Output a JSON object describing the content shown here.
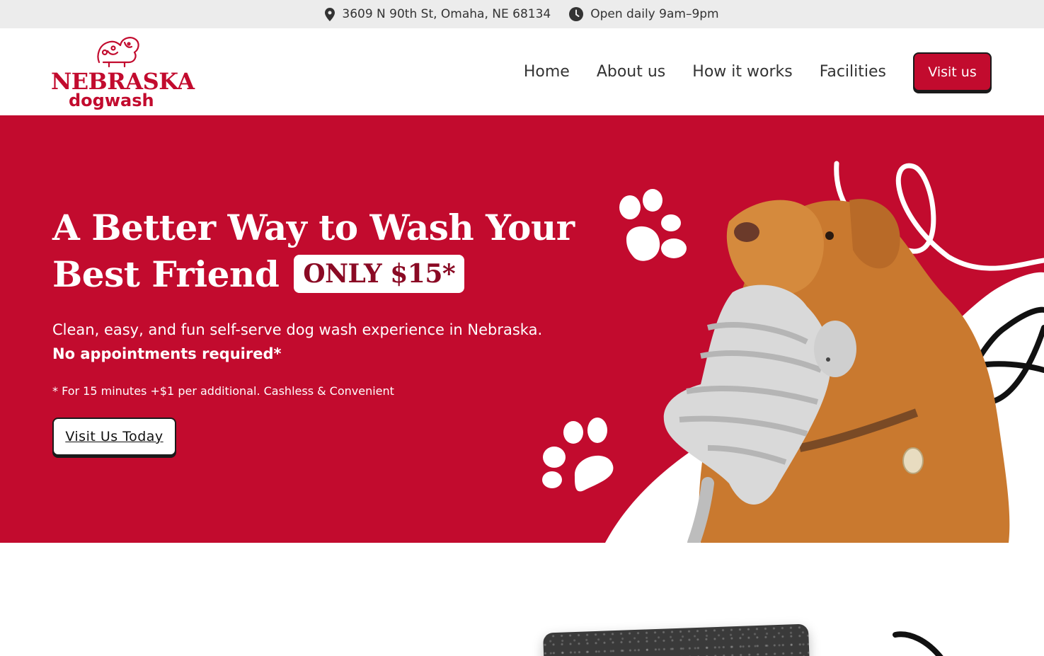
{
  "topbar": {
    "address": "3609 N 90th St, Omaha, NE 68134",
    "address_icon": "location-pin-icon",
    "hours": "Open daily 9am–9pm",
    "hours_icon": "clock-icon"
  },
  "brand": {
    "name_line1": "NEBRASKA",
    "name_line2": "dogwash",
    "color": "#c20b2e"
  },
  "nav": {
    "items": [
      {
        "label": "Home"
      },
      {
        "label": "About us"
      },
      {
        "label": "How it works"
      },
      {
        "label": "Facilities"
      }
    ],
    "cta_label": "Visit us"
  },
  "hero": {
    "title": "A Better Way to Wash Your Best Friend",
    "badge": "ONLY $15*",
    "lead": "Clean, easy, and fun self-serve dog wash experience in Nebraska.",
    "lead_bold": "No appointments required*",
    "note": "* For 15 minutes +$1 per additional. Cashless & Convenient",
    "cta_label": "Visit Us Today",
    "background": "#c20b2e"
  }
}
